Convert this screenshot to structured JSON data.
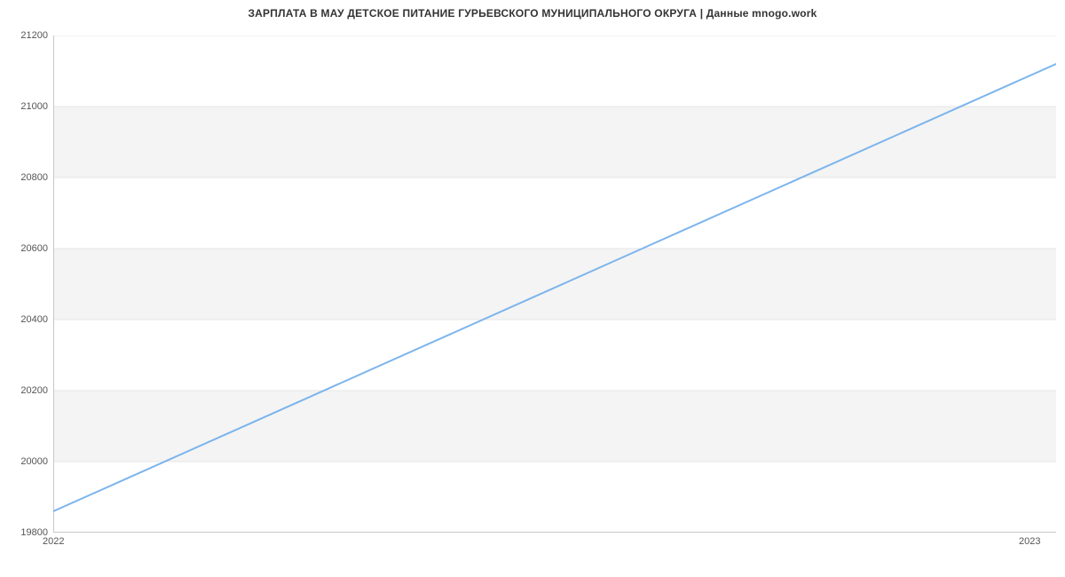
{
  "title": "ЗАРПЛАТА В МАУ ДЕТСКОЕ ПИТАНИЕ ГУРЬЕВСКОГО МУНИЦИПАЛЬНОГО ОКРУГА | Данные mnogo.work",
  "y_ticks": [
    "19800",
    "20000",
    "20200",
    "20400",
    "20600",
    "20800",
    "21000",
    "21200"
  ],
  "x_ticks": [
    "2022",
    "2023"
  ],
  "chart_data": {
    "type": "line",
    "title": "ЗАРПЛАТА В МАУ ДЕТСКОЕ ПИТАНИЕ ГУРЬЕВСКОГО МУНИЦИПАЛЬНОГО ОКРУГА | Данные mnogo.work",
    "xlabel": "",
    "ylabel": "",
    "x": [
      "2022",
      "2023"
    ],
    "values": [
      19860,
      21120
    ],
    "ylim": [
      19800,
      21200
    ],
    "xlim": [
      "2022",
      "2023"
    ],
    "grid": true
  }
}
